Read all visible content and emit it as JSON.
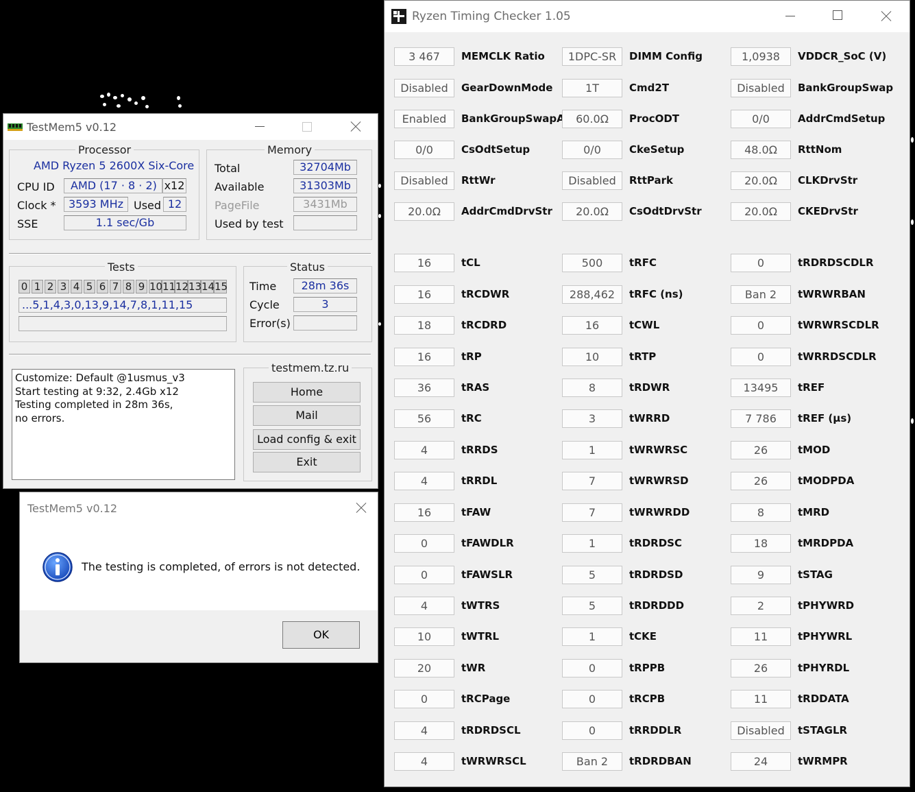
{
  "rtc": {
    "title": "Ryzen Timing Checker 1.05",
    "columns": [
      [
        {
          "value": "3 467",
          "label": "MEMCLK Ratio"
        },
        {
          "value": "Disabled",
          "label": "GearDownMode"
        },
        {
          "value": "Enabled",
          "label": "BankGroupSwapAlt"
        },
        {
          "value": "0/0",
          "label": "CsOdtSetup"
        },
        {
          "value": "Disabled",
          "label": "RttWr"
        },
        {
          "value": "20.0Ω",
          "label": "AddrCmdDrvStr"
        },
        {
          "value": "16",
          "label": "tCL"
        },
        {
          "value": "16",
          "label": "tRCDWR"
        },
        {
          "value": "18",
          "label": "tRCDRD"
        },
        {
          "value": "16",
          "label": "tRP"
        },
        {
          "value": "36",
          "label": "tRAS"
        },
        {
          "value": "56",
          "label": "tRC"
        },
        {
          "value": "4",
          "label": "tRRDS"
        },
        {
          "value": "4",
          "label": "tRRDL"
        },
        {
          "value": "16",
          "label": "tFAW"
        },
        {
          "value": "0",
          "label": "tFAWDLR"
        },
        {
          "value": "0",
          "label": "tFAWSLR"
        },
        {
          "value": "4",
          "label": "tWTRS"
        },
        {
          "value": "10",
          "label": "tWTRL"
        },
        {
          "value": "20",
          "label": "tWR"
        },
        {
          "value": "0",
          "label": "tRCPage"
        },
        {
          "value": "4",
          "label": "tRDRDSCL"
        },
        {
          "value": "4",
          "label": "tWRWRSCL"
        }
      ],
      [
        {
          "value": "1DPC-SR",
          "label": "DIMM Config"
        },
        {
          "value": "1T",
          "label": "Cmd2T"
        },
        {
          "value": "60.0Ω",
          "label": "ProcODT"
        },
        {
          "value": "0/0",
          "label": "CkeSetup"
        },
        {
          "value": "Disabled",
          "label": "RttPark"
        },
        {
          "value": "20.0Ω",
          "label": "CsOdtDrvStr"
        },
        {
          "value": "500",
          "label": "tRFC"
        },
        {
          "value": "288,462",
          "label": "tRFC (ns)"
        },
        {
          "value": "16",
          "label": "tCWL"
        },
        {
          "value": "10",
          "label": "tRTP"
        },
        {
          "value": "8",
          "label": "tRDWR"
        },
        {
          "value": "3",
          "label": "tWRRD"
        },
        {
          "value": "1",
          "label": "tWRWRSC"
        },
        {
          "value": "7",
          "label": "tWRWRSD"
        },
        {
          "value": "7",
          "label": "tWRWRDD"
        },
        {
          "value": "1",
          "label": "tRDRDSC"
        },
        {
          "value": "5",
          "label": "tRDRDSD"
        },
        {
          "value": "5",
          "label": "tRDRDDD"
        },
        {
          "value": "1",
          "label": "tCKE"
        },
        {
          "value": "0",
          "label": "tRPPB"
        },
        {
          "value": "0",
          "label": "tRCPB"
        },
        {
          "value": "0",
          "label": "tRRDDLR"
        },
        {
          "value": "Ban 2",
          "label": "tRDRDBAN"
        }
      ],
      [
        {
          "value": "1,0938",
          "label": "VDDCR_SoC (V)"
        },
        {
          "value": "Disabled",
          "label": "BankGroupSwap"
        },
        {
          "value": "0/0",
          "label": "AddrCmdSetup"
        },
        {
          "value": "48.0Ω",
          "label": "RttNom"
        },
        {
          "value": "20.0Ω",
          "label": "CLKDrvStr"
        },
        {
          "value": "20.0Ω",
          "label": "CKEDrvStr"
        },
        {
          "value": "0",
          "label": "tRDRDSCDLR"
        },
        {
          "value": "Ban 2",
          "label": "tWRWRBAN"
        },
        {
          "value": "0",
          "label": "tWRWRSCDLR"
        },
        {
          "value": "0",
          "label": "tWRRDSCDLR"
        },
        {
          "value": "13495",
          "label": "tREF"
        },
        {
          "value": "7 786",
          "label": "tREF (μs)"
        },
        {
          "value": "26",
          "label": "tMOD"
        },
        {
          "value": "26",
          "label": "tMODPDA"
        },
        {
          "value": "8",
          "label": "tMRD"
        },
        {
          "value": "18",
          "label": "tMRDPDA"
        },
        {
          "value": "9",
          "label": "tSTAG"
        },
        {
          "value": "2",
          "label": "tPHYWRD"
        },
        {
          "value": "11",
          "label": "tPHYWRL"
        },
        {
          "value": "26",
          "label": "tPHYRDL"
        },
        {
          "value": "11",
          "label": "tRDDATA"
        },
        {
          "value": "Disabled",
          "label": "tSTAGLR"
        },
        {
          "value": "24",
          "label": "tWRMPR"
        }
      ]
    ]
  },
  "testmem": {
    "title": "TestMem5 v0.12",
    "processor": {
      "group_title": "Processor",
      "name": "AMD Ryzen 5 2600X Six-Core",
      "cpuid_label": "CPU ID",
      "cpuid_value": "AMD  (17 · 8 · 2)",
      "threads": "x12",
      "clock_label": "Clock *",
      "clock_value": "3593 MHz",
      "used_label": "Used",
      "used_value": "12",
      "sse_label": "SSE",
      "sse_value": "1.1 sec/Gb"
    },
    "memory": {
      "group_title": "Memory",
      "total_label": "Total",
      "total_value": "32704Mb",
      "available_label": "Available",
      "available_value": "31303Mb",
      "pagefile_label": "PageFile",
      "pagefile_value": "3431Mb",
      "usedbytest_label": "Used by test",
      "usedbytest_value": ""
    },
    "tests": {
      "group_title": "Tests",
      "numbers": [
        "0",
        "1",
        "2",
        "3",
        "4",
        "5",
        "6",
        "7",
        "8",
        "9",
        "10",
        "11",
        "12",
        "13",
        "14",
        "15"
      ],
      "sequence": "...5,1,4,3,0,13,9,14,7,8,1,11,15",
      "progress": ""
    },
    "status": {
      "group_title": "Status",
      "time_label": "Time",
      "time_value": "28m 36s",
      "cycle_label": "Cycle",
      "cycle_value": "3",
      "errors_label": "Error(s)",
      "errors_value": ""
    },
    "log": [
      "Customize: Default @1usmus_v3",
      "Start testing at 9:32, 2.4Gb x12",
      "Testing completed in 28m 36s,",
      "no errors."
    ],
    "links": {
      "group_title": "testmem.tz.ru",
      "home": "Home",
      "mail": "Mail",
      "load_exit": "Load config & exit",
      "exit": "Exit"
    }
  },
  "dialog": {
    "title": "TestMem5 v0.12",
    "message": "The testing is completed, of errors is not detected.",
    "ok": "OK"
  }
}
